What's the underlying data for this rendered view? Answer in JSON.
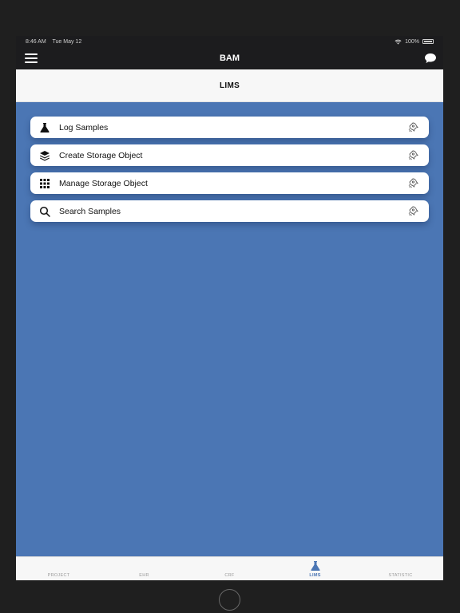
{
  "status_bar": {
    "time": "8:46 AM",
    "date": "Tue May 12",
    "battery": "100%"
  },
  "nav": {
    "title": "BAM"
  },
  "section": {
    "title": "LIMS"
  },
  "menu_items": [
    {
      "label": "Log Samples",
      "icon": "flask-icon"
    },
    {
      "label": "Create Storage Object",
      "icon": "layers-icon"
    },
    {
      "label": "Manage Storage Object",
      "icon": "grid-icon"
    },
    {
      "label": "Search Samples",
      "icon": "search-icon"
    }
  ],
  "tabs": [
    {
      "label": "PROJECT",
      "active": false
    },
    {
      "label": "EHR",
      "active": false
    },
    {
      "label": "CRF",
      "active": false
    },
    {
      "label": "LIMS",
      "active": true
    },
    {
      "label": "STATISTIC",
      "active": false
    }
  ],
  "colors": {
    "accent": "#4b76b4",
    "nav_bg": "#1c1c1e",
    "header_bg": "#f7f7f7"
  }
}
